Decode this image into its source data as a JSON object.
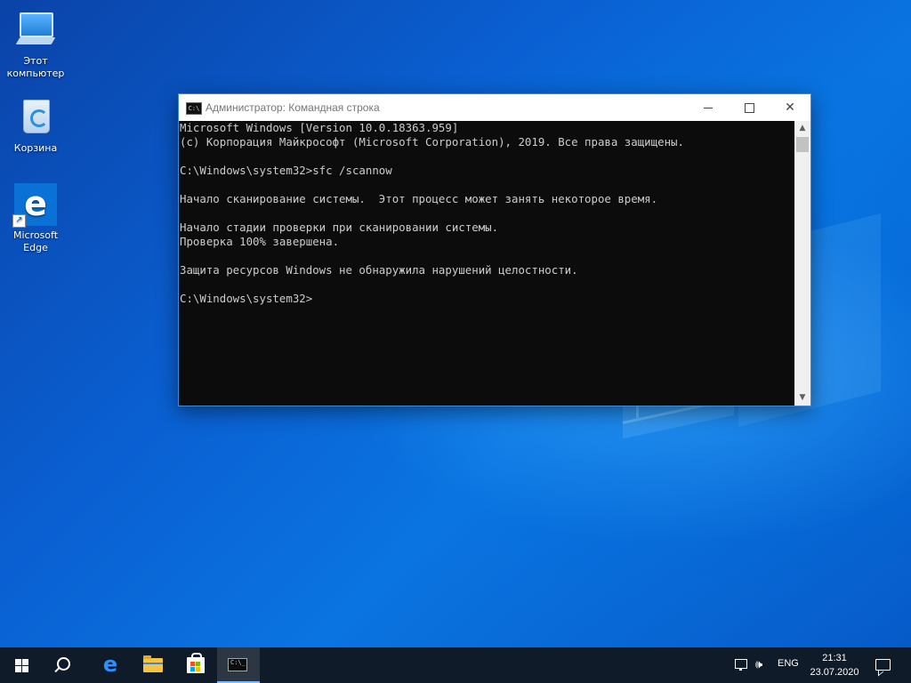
{
  "desktop": {
    "icons": [
      {
        "label": "Этот компьютер",
        "icon": "computer-icon"
      },
      {
        "label": "Корзина",
        "icon": "recycle-bin-icon"
      },
      {
        "label": "Microsoft Edge",
        "icon": "edge-icon"
      }
    ]
  },
  "window": {
    "title": "Администратор: Командная строка",
    "console_lines": [
      "Microsoft Windows [Version 10.0.18363.959]",
      "(c) Корпорация Майкрософт (Microsoft Corporation), 2019. Все права защищены.",
      "",
      "C:\\Windows\\system32>sfc /scannow",
      "",
      "Начало сканирование системы.  Этот процесс может занять некоторое время.",
      "",
      "Начало стадии проверки при сканировании системы.",
      "Проверка 100% завершена.",
      "",
      "Защита ресурсов Windows не обнаружила нарушений целостности.",
      "",
      "C:\\Windows\\system32>"
    ],
    "close_glyph": "✕",
    "scroll_up_glyph": "▲",
    "scroll_down_glyph": "▼"
  },
  "taskbar": {
    "items": [
      "start-icon",
      "search-icon",
      "edge-icon",
      "file-explorer-icon",
      "store-icon",
      "command-prompt-icon"
    ],
    "tray": {
      "language": "ENG",
      "time": "21:31",
      "date": "23.07.2020"
    }
  },
  "colors": {
    "console_bg": "#0c0c0c",
    "console_text": "#cccccc",
    "taskbar_bg": "#101b2a",
    "accent": "#0a72d6"
  }
}
